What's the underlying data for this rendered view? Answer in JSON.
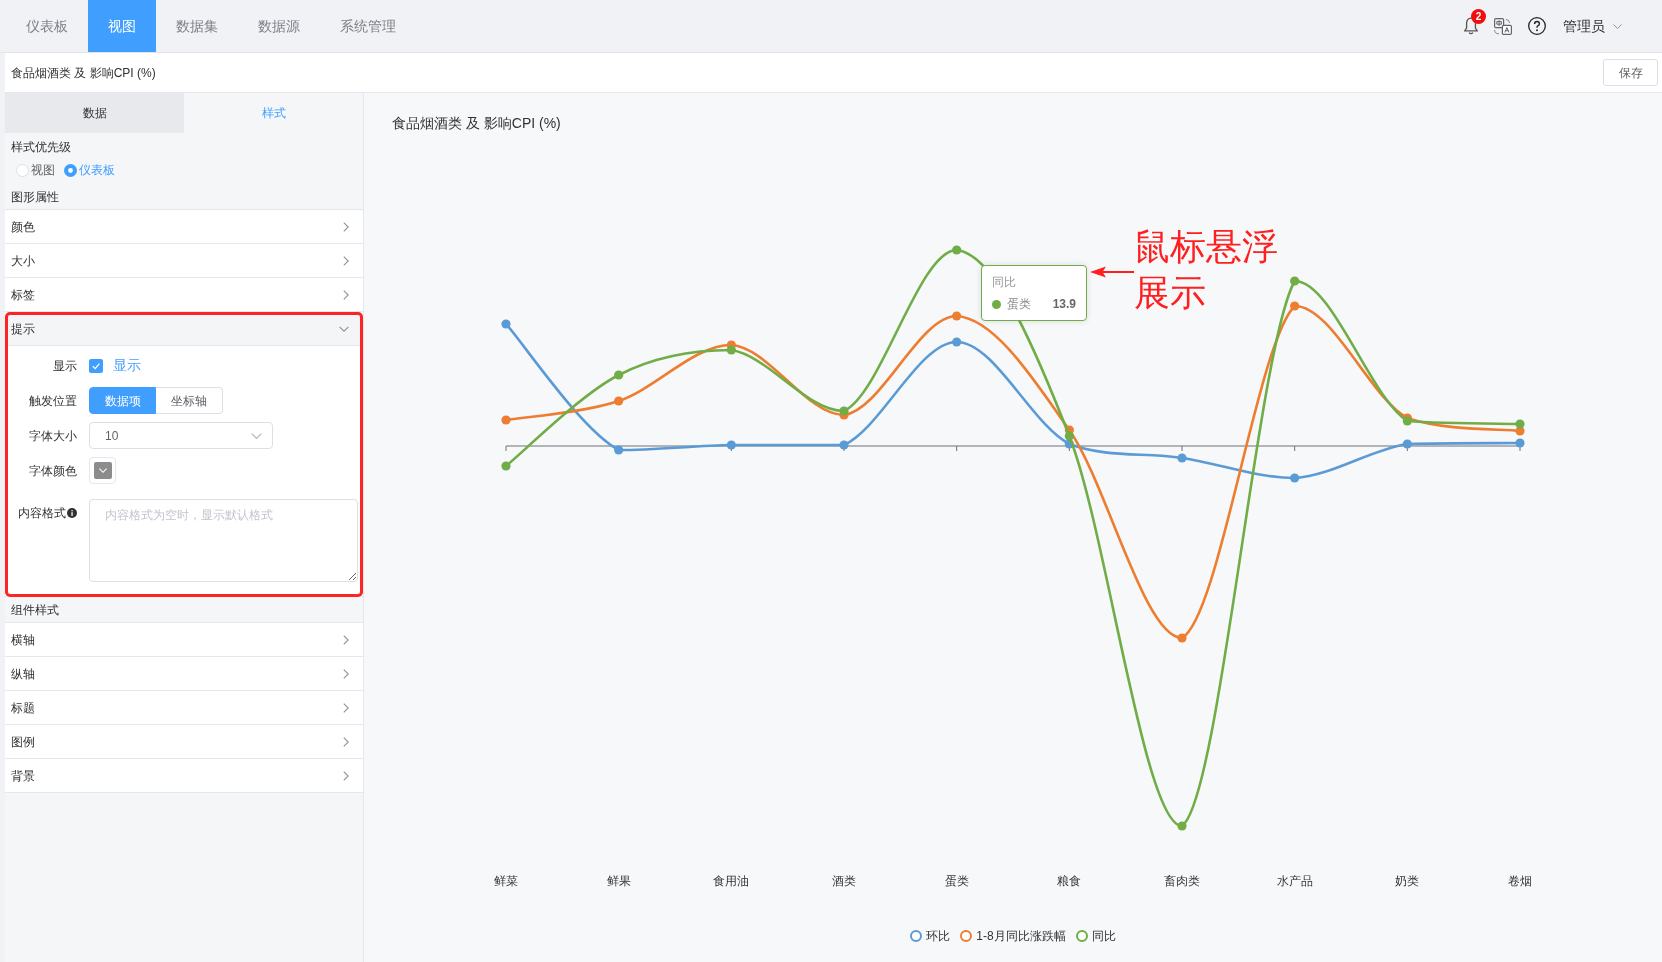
{
  "top_nav": {
    "tabs": [
      {
        "label": "仪表板",
        "selected": false
      },
      {
        "label": "视图",
        "selected": true
      },
      {
        "label": "数据集",
        "selected": false
      },
      {
        "label": "数据源",
        "selected": false
      },
      {
        "label": "系统管理",
        "selected": false
      }
    ],
    "notification_count": "2",
    "user": "管理员"
  },
  "view_bar": {
    "title": "食品烟酒类 及 影响CPI (%)",
    "save_button": "保存"
  },
  "editor": {
    "tabs": [
      {
        "label": "数据",
        "selected": false
      },
      {
        "label": "样式",
        "selected": true
      }
    ],
    "style_priority": {
      "label": "样式优先级",
      "options": [
        {
          "label": "视图",
          "selected": false
        },
        {
          "label": "仪表板",
          "selected": true
        }
      ]
    },
    "sections": [
      {
        "title": "图形属性",
        "items": [
          {
            "label": "颜色",
            "expanded": false,
            "highlighted": false
          },
          {
            "label": "大小",
            "expanded": false,
            "highlighted": false
          },
          {
            "label": "标签",
            "expanded": false,
            "highlighted": false
          },
          {
            "label": "提示",
            "expanded": true,
            "highlighted": true,
            "fields": [
              {
                "kind": "checkbox",
                "label": "显示",
                "option": "显示",
                "checked": true
              },
              {
                "kind": "segmented",
                "label": "触发位置",
                "options": [
                  {
                    "label": "数据项",
                    "selected": true
                  },
                  {
                    "label": "坐标轴",
                    "selected": false
                  }
                ]
              },
              {
                "kind": "select",
                "label": "字体大小",
                "value": "10"
              },
              {
                "kind": "color",
                "label": "字体颜色",
                "color": "#8c8c8c"
              },
              {
                "kind": "textarea",
                "label": "内容格式",
                "info": true,
                "placeholder": "内容格式为空时，显示默认格式"
              }
            ]
          }
        ]
      },
      {
        "title": "组件样式",
        "items": [
          {
            "label": "横轴",
            "expanded": false,
            "highlighted": false
          },
          {
            "label": "纵轴",
            "expanded": false,
            "highlighted": false
          },
          {
            "label": "标题",
            "expanded": false,
            "highlighted": false
          },
          {
            "label": "图例",
            "expanded": false,
            "highlighted": false
          },
          {
            "label": "背景",
            "expanded": false,
            "highlighted": false
          }
        ]
      }
    ]
  },
  "chart": {
    "title": "食品烟酒类 及 影响CPI (%)",
    "x_labels": [
      "鲜菜",
      "鲜果",
      "食用油",
      "酒类",
      "蛋类",
      "粮食",
      "畜肉类",
      "水产品",
      "奶类",
      "卷烟"
    ],
    "legend": [
      {
        "label": "环比",
        "color": "#5b9bd5"
      },
      {
        "label": "1-8月同比涨跌幅",
        "color": "#ed7d31"
      },
      {
        "label": "同比",
        "color": "#70ad47"
      }
    ],
    "tooltip": {
      "title": "同比",
      "color": "#70ad47",
      "category": "蛋类",
      "value": "13.9"
    },
    "annotation": {
      "lines": [
        "鼠标悬浮",
        "展示"
      ]
    }
  }
}
